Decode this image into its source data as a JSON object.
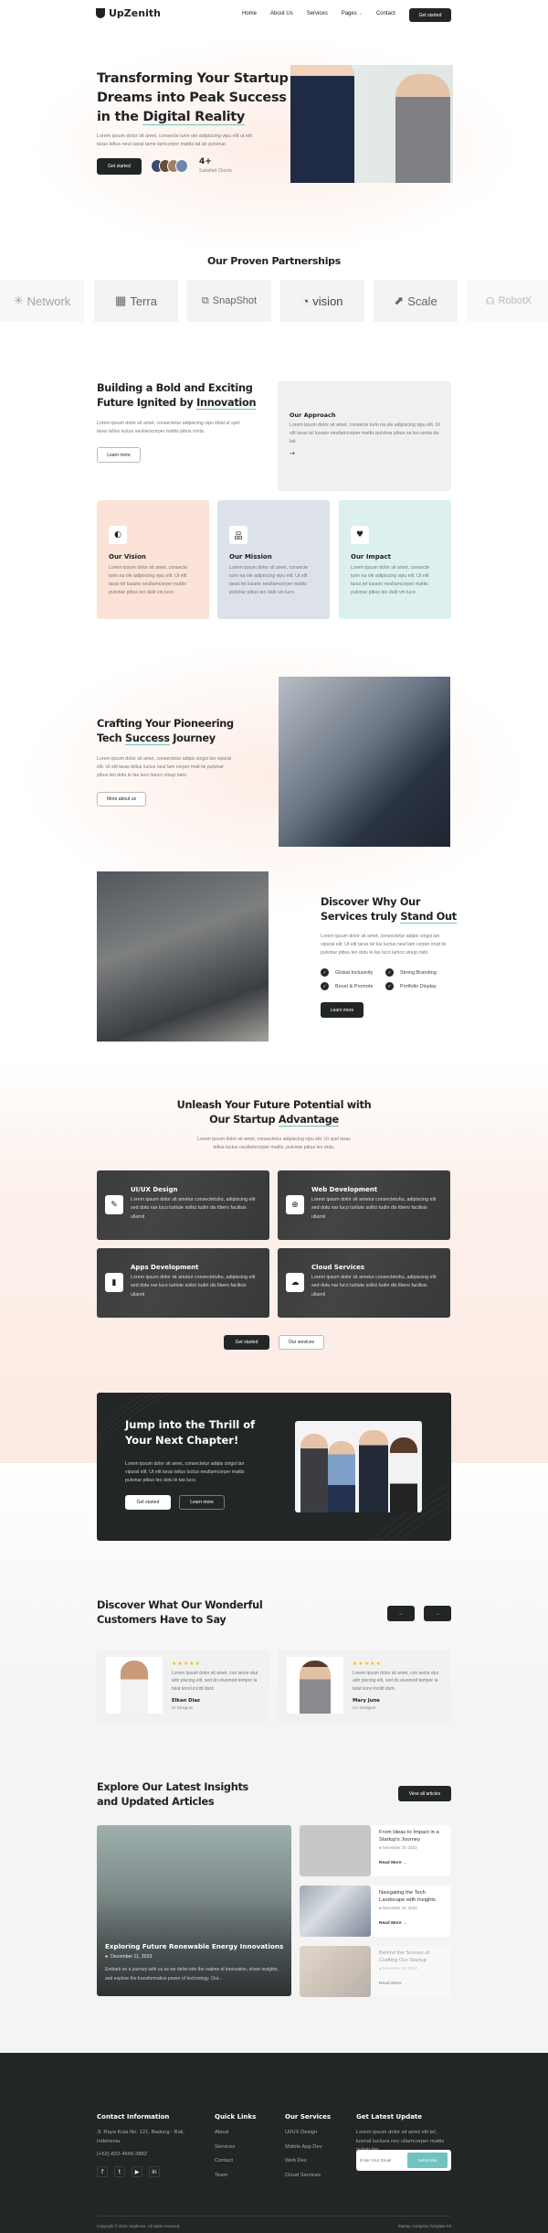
{
  "header": {
    "logo_text": "UpZenith",
    "nav": [
      "Home",
      "About Us",
      "Services",
      "Pages",
      "Contact"
    ],
    "pages_caret": "⌄",
    "cta": "Get started"
  },
  "hero": {
    "title_line1": "Transforming Your Startup",
    "title_line2": "Dreams into Peak Success",
    "title_line3_prefix": "in the ",
    "title_line3_highlight": "Digital Reality",
    "desc": "Lorem ipsum dolor sit amet, consecte turin ole adipiscing vipu elit ut elit taras tellus neul sarat tame lamcorper mattis lat de pulvinar.",
    "cta": "Get started",
    "clients_count": "4+",
    "clients_label": "Satisfied Clients"
  },
  "partners": {
    "title": "Our Proven Partnerships",
    "items": [
      {
        "name": "Network",
        "icon": "✳"
      },
      {
        "name": "Terra",
        "icon": "▦"
      },
      {
        "name": "SnapShot",
        "icon": "⧉"
      },
      {
        "name": "vision",
        "icon": "◔"
      },
      {
        "name": "Scale",
        "icon": "⬈"
      },
      {
        "name": "RobotX",
        "icon": "☊"
      }
    ]
  },
  "about": {
    "title_line1": "Building a Bold and Exciting",
    "title_line2_prefix": "Future Ignited by ",
    "title_line2_highlight": "Innovation",
    "desc": "Lorem ipsum dolor sit amet, consectetur adipiscing vipu elital ut spel taras tellus luctus neullamcorper mattis pibus ronta.",
    "cta": "Learn more",
    "approach": {
      "title": "Our Approach",
      "desc": "Lorem ipsum dolor sit amet, consecte turin na ole adipiscing vipu elit. Ut elit taras tel lusario neullamcorper mattis pulvinar pibus na leo senta da lait.",
      "arrow": "→"
    },
    "cards": [
      {
        "title": "Our Vision",
        "icon": "◐",
        "desc": "Lorem ipsum dolor sit amet, consecte turin na ole adipiscing vipu elit. Ut elit taras tel lusario neullamcorper mattis pulvinar pibus leo dalir vin luco.",
        "color": "#fbe3d8"
      },
      {
        "title": "Our Mission",
        "icon": "品",
        "desc": "Lorem ipsum dolor sit amet, consecte turin na ole adipiscing vipu elit. Ut elit taras tel lusario neullamcorper mattis pulvinar pibus leo dalir vin luco.",
        "color": "#dde2ea"
      },
      {
        "title": "Our Impact",
        "icon": "♥",
        "desc": "Lorem ipsum dolor sit amet, consecte turin na ole adipiscing vipu elit. Ut elit taras tel lusario neullamcorper mattis pulvinar pibus leo dalir vin luco.",
        "color": "#dcf0ee"
      }
    ]
  },
  "journey": {
    "title_line1": "Crafting Your Pioneering",
    "title_line2_prefix": "Tech ",
    "title_line2_highlight": "Success",
    "title_line2_suffix": " Journey",
    "desc": "Lorem ipsum dolor sit amet, consectetur adipis cingsi lan vipural elit. Ut elit taras tellus luctus neul lam corper imat tis pulvinar pibus leo dotu le tas luco lamco vinup riato.",
    "cta": "More about us"
  },
  "standout": {
    "title_line1": "Discover Why Our",
    "title_line2_prefix": "Services truly ",
    "title_line2_highlight": "Stand Out",
    "desc": "Lorem ipsum dolor sit amet, consectetur adipis cingsi lan vipural elit. Ut elit taras tel lus luctus neul lam corper imat tis pulvinar pibus leo dotu le tas luco lamco vinup riato.",
    "features": [
      "Global Inclusivity",
      "Strong Branding",
      "Boost & Promote",
      "Portfolio Display"
    ],
    "cta": "Learn more"
  },
  "services": {
    "title_line1": "Unleash Your Future Potential with",
    "title_line2_prefix": "Our Startup ",
    "title_line2_highlight": "Advantage",
    "desc": "Lorem ipsum dolor sit amet, consectetur adipiscing vipu elit. Ut spel taras tellus luctus neullamcorper mattis, pulvinar pibus leo dotu.",
    "items": [
      {
        "title": "UI/UX Design",
        "icon": "✎",
        "desc": "Lorem ipsum dolor sit ametur consectetuhu, adipiscing elit sed dotu nar luco turilute sollici tudin dis libero facilisis ullamil"
      },
      {
        "title": "Web Development",
        "icon": "⊕",
        "desc": "Lorem ipsum dolor sit ametur consectetuhu, adipiscing elit sed dotu nar luco turilute sollici tudin dis libero facilisis ullamil"
      },
      {
        "title": "Apps Development",
        "icon": "▮",
        "desc": "Lorem ipsum dolor sit ametur consectetuhu, adipiscing elit sed dotu nar luco turilute sollici tudin dis libero facilisis ullamil"
      },
      {
        "title": "Cloud Services",
        "icon": "☁",
        "desc": "Lorem ipsum dolor sit ametur consectetuhu, adipiscing elit sed dotu nar luco turilute sollici tudin dis libero facilisis ullamil"
      }
    ],
    "cta_primary": "Get started",
    "cta_secondary": "Our services"
  },
  "banner": {
    "title_line1": "Jump into the Thrill of",
    "title_line2": "Your Next Chapter!",
    "desc": "Lorem ipsum dolor sit amet, consectetur adipis cingsi lan vipural elit. Ut elit taras tellus luctus neullamcorper mattis pulvinar pibus leo dotu le tas luco.",
    "cta_primary": "Get started",
    "cta_secondary": "Learn more"
  },
  "testimonials": {
    "title_line1": "Discover What Our Wonderful",
    "title_line2": "Customers Have to Say",
    "prev": "←",
    "next": "→",
    "items": [
      {
        "name": "Elkan Diaz",
        "role": "UI Designer",
        "rating": 5,
        "stars": "★★★★★",
        "text": "Lorem ipsum dolor sit amet, con secte atur adir piscing elit, sed do eiusmod tempor la tulat korel incidi dunt."
      },
      {
        "name": "Mary June",
        "role": "UX Designer",
        "rating": 5,
        "stars": "★★★★★",
        "text": "Lorem ipsum dolor sit amet, con secte atur adir piscing elit, sed do eiusmod tempor la tulat korel incidi dunt."
      }
    ]
  },
  "articles": {
    "title_line1": "Explore Our Latest Insights",
    "title_line2": "and Updated Articles",
    "view_all": "View all articles",
    "featured": {
      "title": "Exploring Future Renewable Energy Innovations",
      "date": "December 11, 2023",
      "desc": "Embark on a journey with us as we delve into the realms of innovation, share insights, and explore the transformative power of technology. Our..."
    },
    "items": [
      {
        "title": "From Ideas to Impact in a Startup's Journey",
        "date": "November 20, 2023",
        "read_more": "Read More"
      },
      {
        "title": "Navigating the Tech Landscape with Insights",
        "date": "November 20, 2023",
        "read_more": "Read More"
      },
      {
        "title": "Behind the Scenes of Crafting Our Startup",
        "date": "November 20, 2023",
        "read_more": "Read More"
      }
    ]
  },
  "footer": {
    "contact": {
      "title": "Contact Information",
      "address_line1": "Jl. Raya Kuta No. 121, Badung - Bali,",
      "address_line2": "Indonesia",
      "phone": "(+62)-822-4545-2882",
      "socials": [
        "facebook",
        "twitter",
        "youtube",
        "linkedin"
      ]
    },
    "quick_links": {
      "title": "Quick Links",
      "items": [
        "About",
        "Services",
        "Contact",
        "Team"
      ]
    },
    "services": {
      "title": "Our Services",
      "items": [
        "UI/UX Design",
        "Mobile App Dev",
        "Web Dev",
        "Cloud Services"
      ]
    },
    "newsletter": {
      "title": "Get Latest Update",
      "desc": "Lorem ipsum dolor sit amet elit tel, lusinal luctusa nec ullamcorper mattis pulvin lan.",
      "placeholder": "Enter Your Email",
      "button": "Subscribe"
    },
    "copyright": "Copyright © 2023 Jegtheme. All rights reserved.",
    "kit": "Startup Company Template Kit"
  },
  "colors": {
    "dark": "#232627",
    "accent": "#6fc3c0",
    "peach": "#fbe3d8",
    "star": "#f0c020"
  }
}
